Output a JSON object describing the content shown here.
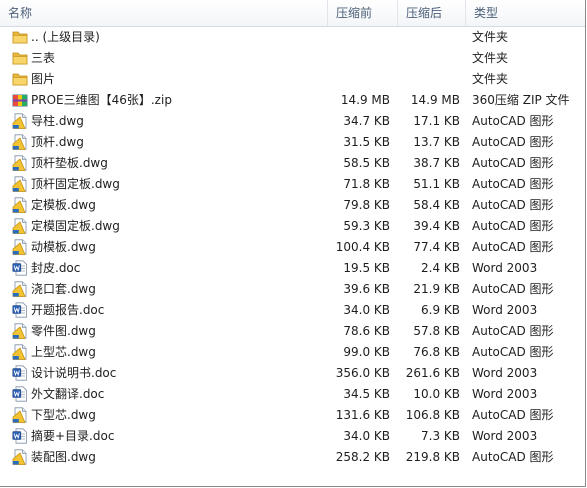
{
  "columns": {
    "name": "名称",
    "before": "压缩前",
    "after": "压缩后",
    "type": "类型"
  },
  "rows": [
    {
      "name": ".. (上级目录)",
      "before": "",
      "after": "",
      "type": "文件夹",
      "icon": "folder-icon"
    },
    {
      "name": "三表",
      "before": "",
      "after": "",
      "type": "文件夹",
      "icon": "folder-icon"
    },
    {
      "name": "图片",
      "before": "",
      "after": "",
      "type": "文件夹",
      "icon": "folder-icon"
    },
    {
      "name": "PROE三维图【46张】.zip",
      "before": "14.9 MB",
      "after": "14.9 MB",
      "type": "360压缩 ZIP 文件",
      "icon": "zip-icon"
    },
    {
      "name": "导柱.dwg",
      "before": "34.7 KB",
      "after": "17.1 KB",
      "type": "AutoCAD 图形",
      "icon": "dwg-icon"
    },
    {
      "name": "顶杆.dwg",
      "before": "31.5 KB",
      "after": "13.7 KB",
      "type": "AutoCAD 图形",
      "icon": "dwg-icon"
    },
    {
      "name": "顶杆垫板.dwg",
      "before": "58.5 KB",
      "after": "38.7 KB",
      "type": "AutoCAD 图形",
      "icon": "dwg-icon"
    },
    {
      "name": "顶杆固定板.dwg",
      "before": "71.8 KB",
      "after": "51.1 KB",
      "type": "AutoCAD 图形",
      "icon": "dwg-icon"
    },
    {
      "name": "定模板.dwg",
      "before": "79.8 KB",
      "after": "58.4 KB",
      "type": "AutoCAD 图形",
      "icon": "dwg-icon"
    },
    {
      "name": "定模固定板.dwg",
      "before": "59.3 KB",
      "after": "39.4 KB",
      "type": "AutoCAD 图形",
      "icon": "dwg-icon"
    },
    {
      "name": "动模板.dwg",
      "before": "100.4 KB",
      "after": "77.4 KB",
      "type": "AutoCAD 图形",
      "icon": "dwg-icon"
    },
    {
      "name": "封皮.doc",
      "before": "19.5 KB",
      "after": "2.4 KB",
      "type": "Word 2003",
      "icon": "doc-icon"
    },
    {
      "name": "浇口套.dwg",
      "before": "39.6 KB",
      "after": "21.9 KB",
      "type": "AutoCAD 图形",
      "icon": "dwg-icon"
    },
    {
      "name": "开题报告.doc",
      "before": "34.0 KB",
      "after": "6.9 KB",
      "type": "Word 2003",
      "icon": "doc-icon"
    },
    {
      "name": "零件图.dwg",
      "before": "78.6 KB",
      "after": "57.8 KB",
      "type": "AutoCAD 图形",
      "icon": "dwg-icon"
    },
    {
      "name": "上型芯.dwg",
      "before": "99.0 KB",
      "after": "76.8 KB",
      "type": "AutoCAD 图形",
      "icon": "dwg-icon"
    },
    {
      "name": "设计说明书.doc",
      "before": "356.0 KB",
      "after": "261.6 KB",
      "type": "Word 2003",
      "icon": "doc-icon"
    },
    {
      "name": "外文翻译.doc",
      "before": "34.5 KB",
      "after": "10.0 KB",
      "type": "Word 2003",
      "icon": "doc-icon"
    },
    {
      "name": "下型芯.dwg",
      "before": "131.6 KB",
      "after": "106.8 KB",
      "type": "AutoCAD 图形",
      "icon": "dwg-icon"
    },
    {
      "name": "摘要+目录.doc",
      "before": "34.0 KB",
      "after": "7.3 KB",
      "type": "Word 2003",
      "icon": "doc-icon"
    },
    {
      "name": "装配图.dwg",
      "before": "258.2 KB",
      "after": "219.8 KB",
      "type": "AutoCAD 图形",
      "icon": "dwg-icon"
    }
  ]
}
